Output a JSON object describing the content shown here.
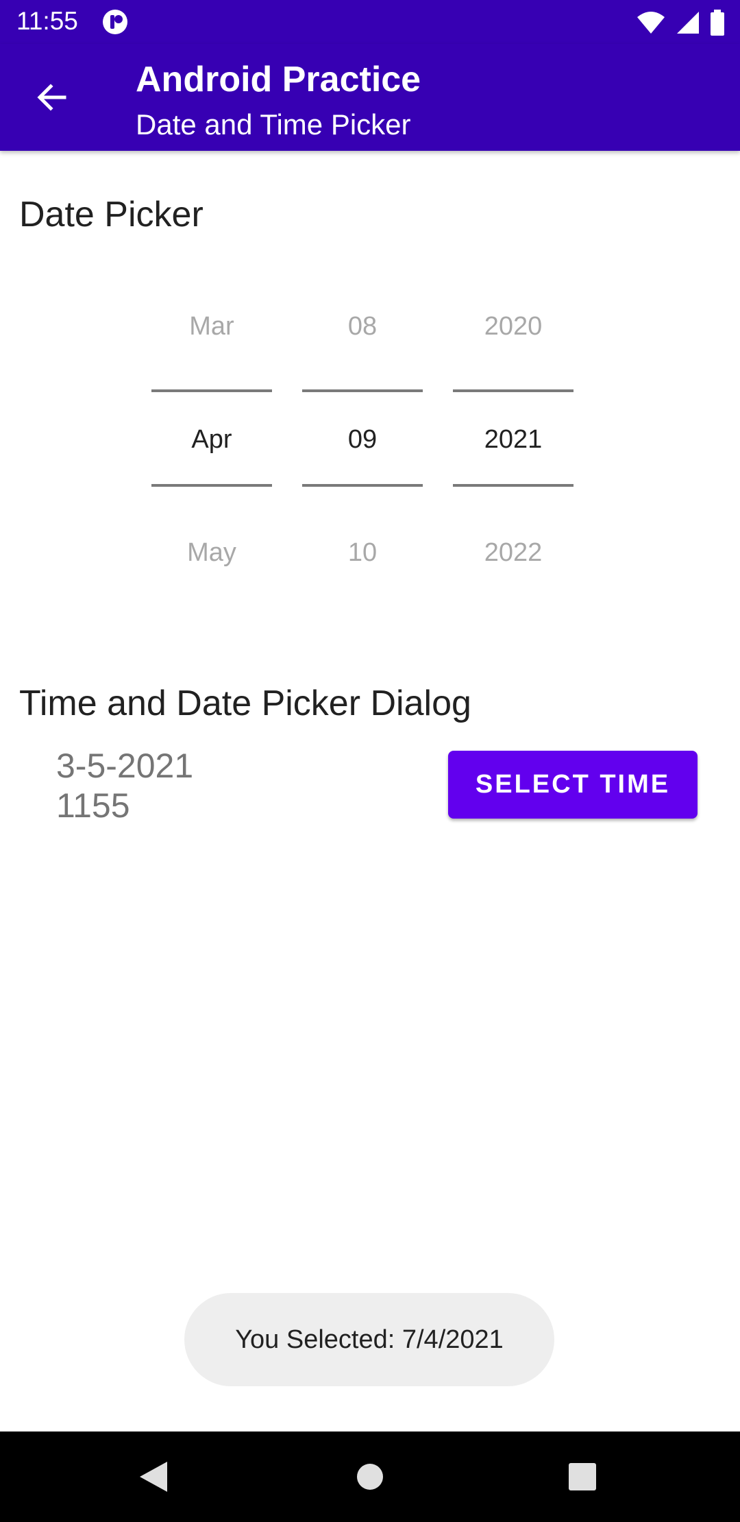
{
  "status_bar": {
    "time": "11:55",
    "icons": [
      "notification-app-icon",
      "wifi-icon",
      "signal-icon",
      "battery-icon"
    ]
  },
  "app_bar": {
    "title": "Android Practice",
    "subtitle": "Date and Time Picker",
    "nav_icon": "back-arrow-icon"
  },
  "date_picker": {
    "heading": "Date Picker",
    "month": {
      "prev": "Mar",
      "selected": "Apr",
      "next": "May"
    },
    "day": {
      "prev": "08",
      "selected": "09",
      "next": "10"
    },
    "year": {
      "prev": "2020",
      "selected": "2021",
      "next": "2022"
    }
  },
  "dialog_section": {
    "heading": "Time and Date Picker Dialog",
    "date_value": "3-5-2021",
    "time_value": "1155",
    "button_label": "SELECT TIME"
  },
  "toast": {
    "text": "You Selected: 7/4/2021"
  },
  "colors": {
    "app_bar": "#3700b3",
    "button": "#6200ee",
    "toast_bg": "#eeeeee",
    "nav_bar": "#000000"
  },
  "nav_bar": {
    "buttons": [
      "back-icon",
      "home-icon",
      "recents-icon"
    ]
  }
}
